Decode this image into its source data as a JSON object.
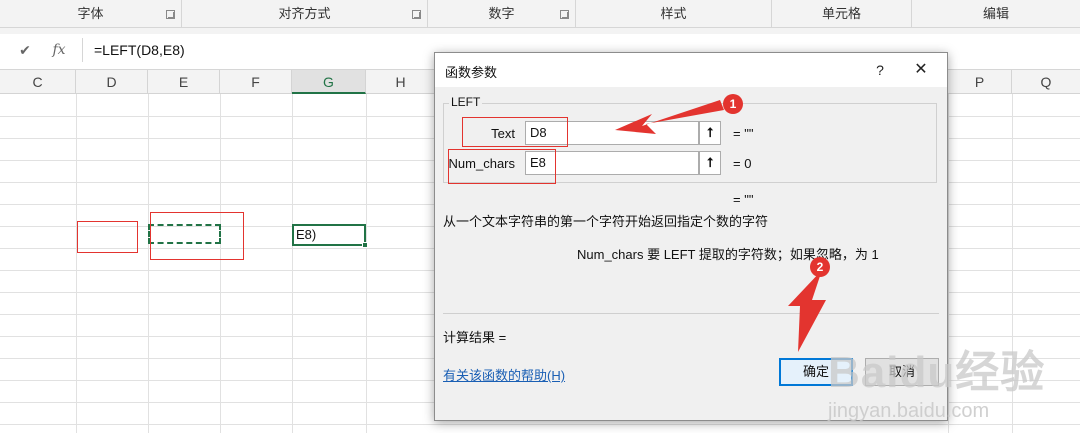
{
  "ribbon": {
    "groups": [
      {
        "label": "字体",
        "has_launcher": true
      },
      {
        "label": "对齐方式",
        "has_launcher": true
      },
      {
        "label": "数字",
        "has_launcher": true
      },
      {
        "label": "样式",
        "has_launcher": false
      },
      {
        "label": "单元格",
        "has_launcher": false
      },
      {
        "label": "编辑",
        "has_launcher": false
      }
    ]
  },
  "formula_bar": {
    "cancel_icon": "✔",
    "fx_label": "fx",
    "formula": "=LEFT(D8,E8)"
  },
  "sheet": {
    "columns": [
      "C",
      "D",
      "E",
      "F",
      "G",
      "H",
      "P",
      "Q"
    ],
    "active_column": "G",
    "active_cell_text": "E8)"
  },
  "dialog": {
    "title": "函数参数",
    "help_label": "?",
    "close_label": "✕",
    "function_name": "LEFT",
    "args": [
      {
        "label": "Text",
        "value": "D8",
        "result": "= \"\""
      },
      {
        "label": "Num_chars",
        "value": "E8",
        "result": "= 0"
      }
    ],
    "function_result": "= \"\"",
    "description": "从一个文本字符串的第一个字符开始返回指定个数的字符",
    "arg_description": "Num_chars  要 LEFT 提取的字符数；如果忽略，为 1",
    "calc_result_label": "计算结果 =",
    "help_link": "有关该函数的帮助(H)",
    "ok_label": "确定",
    "cancel_label": "取消"
  },
  "annotations": {
    "badge1": "1",
    "badge2": "2",
    "color": "#e3342f"
  },
  "watermark": {
    "brand": "Baidu经验",
    "site": "jingyan.baidu.com"
  },
  "colors": {
    "excel_green": "#217346",
    "accent_blue": "#0078d7",
    "annotation_red": "#e3342f"
  }
}
